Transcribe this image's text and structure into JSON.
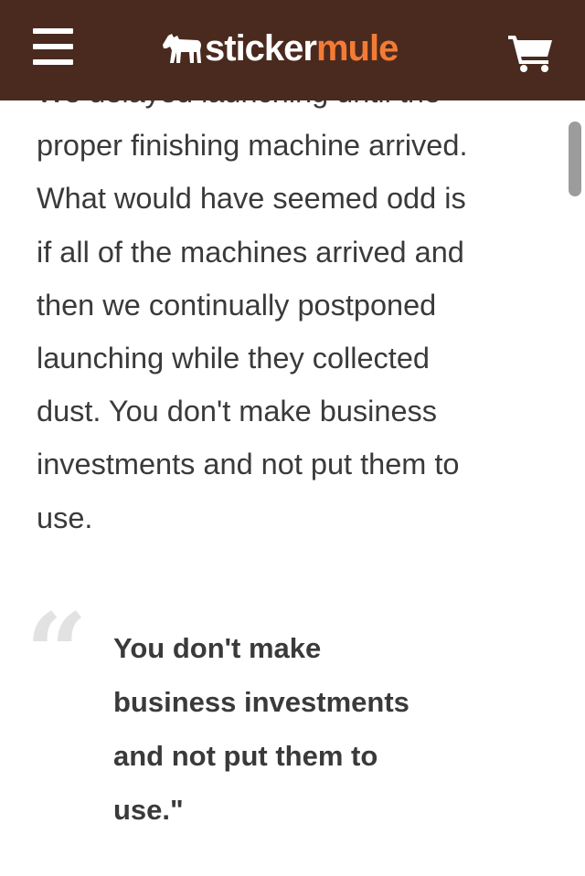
{
  "header": {
    "logo": {
      "sticker": "sticker",
      "mule": "mule"
    },
    "menu_icon": "hamburger-menu-icon",
    "cart_icon": "shopping-cart-icon",
    "background_color": "#4a2a1e",
    "accent_color": "#f37b36"
  },
  "article": {
    "partial_line": "We delayed launching until the",
    "lines": [
      "proper finishing machine arrived.",
      "What would have seemed odd is",
      "if all of the machines arrived and",
      "then we continually postponed",
      "launching while they collected",
      "dust. You don't make business",
      "investments and not put them to",
      "use."
    ]
  },
  "pullquote": {
    "mark": "“",
    "lines": [
      "You don't make",
      "business investments",
      "and not put them to",
      "use.\""
    ]
  }
}
